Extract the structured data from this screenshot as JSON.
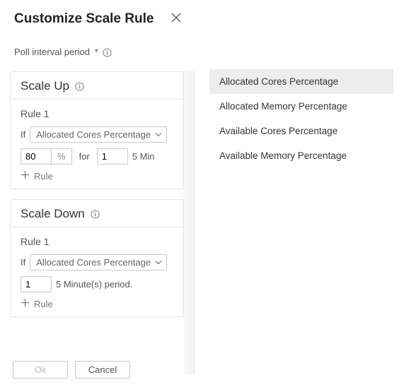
{
  "header": {
    "title": "Customize Scale Rule"
  },
  "field": {
    "label": "Poll interval period",
    "required": "*"
  },
  "scale_up": {
    "title": "Scale Up",
    "rule_title": "Rule 1",
    "if_label": "If",
    "metric": "Allocated Cores Percentage",
    "threshold": "80",
    "threshold_unit": "%",
    "for_label": "for",
    "duration": "1",
    "suffix": "5 Min",
    "add_label": "Rule"
  },
  "scale_down": {
    "title": "Scale Down",
    "rule_title": "Rule 1",
    "if_label": "If",
    "metric": "Allocated Cores Percentage",
    "duration": "1",
    "suffix": "5 Minute(s) period.",
    "add_label": "Rule"
  },
  "footer": {
    "ok": "Ok",
    "cancel": "Cancel"
  },
  "dropdown": {
    "items": [
      "Allocated Cores Percentage",
      "Allocated Memory Percentage",
      "Available Cores Percentage",
      "Available Memory Percentage"
    ],
    "selected_index": 0
  }
}
